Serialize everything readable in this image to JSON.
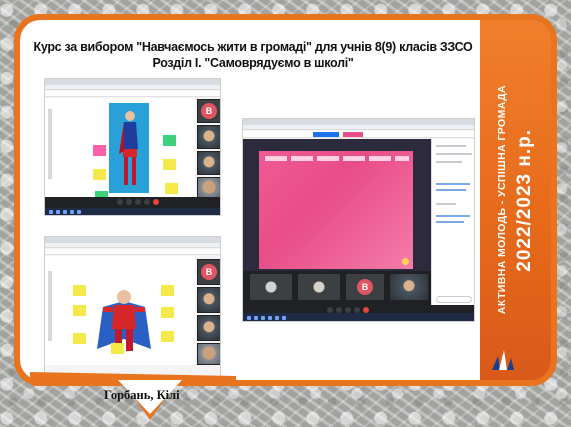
{
  "heading": {
    "line1": "Курс за вибором \"Навчаємось жити в громаді\" для учнів 8(9) класів ЗЗСО",
    "line2": "Розділ І. \"Самоврядуємо в школі\""
  },
  "sidebar": {
    "motto": "АКТИВНА МОЛОДЬ - УСПІШНА ГРОМАДА",
    "year": "2022/2023 н.р."
  },
  "screenshots": {
    "avatar_letter": "В"
  },
  "author_fragment": "Горбань, Кілі"
}
